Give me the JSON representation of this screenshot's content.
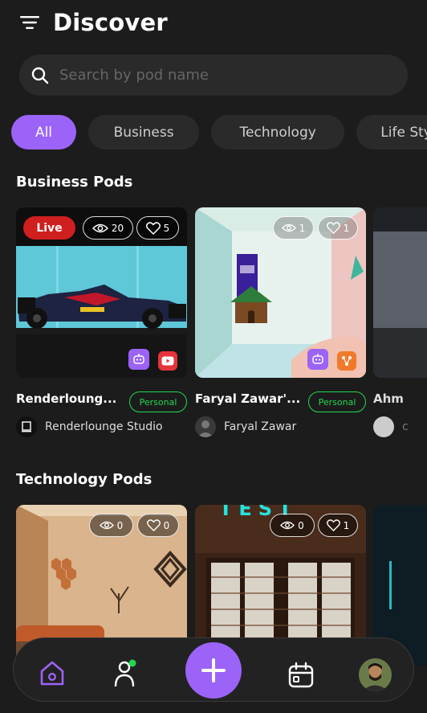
{
  "header": {
    "title": "Discover"
  },
  "search": {
    "placeholder": "Search by pod name"
  },
  "categories": [
    {
      "label": "All",
      "active": true
    },
    {
      "label": "Business"
    },
    {
      "label": "Technology"
    },
    {
      "label": "Life Style"
    }
  ],
  "sections": [
    {
      "title": "Business Pods",
      "cards": [
        {
          "title": "Renderloung...",
          "tag": "Personal",
          "owner": "Renderlounge Studio",
          "live": "Live",
          "views": "20",
          "likes": "5"
        },
        {
          "title": "Faryal Zawar'...",
          "tag": "Personal",
          "owner": "Faryal Zawar",
          "views": "1",
          "likes": "1"
        },
        {
          "title": "Ahm",
          "owner": "c"
        }
      ]
    },
    {
      "title": "Technology Pods",
      "cards": [
        {
          "views": "0",
          "likes": "0"
        },
        {
          "views": "0",
          "likes": "1",
          "sign": "TEST"
        }
      ]
    }
  ],
  "colors": {
    "accent": "#9b63f8",
    "live": "#cf1f1f",
    "personal": "#22d650",
    "background": "#1c1c1c"
  },
  "nav": [
    "home-icon",
    "profile-icon",
    "plus-icon",
    "calendar-icon",
    "user-avatar"
  ]
}
